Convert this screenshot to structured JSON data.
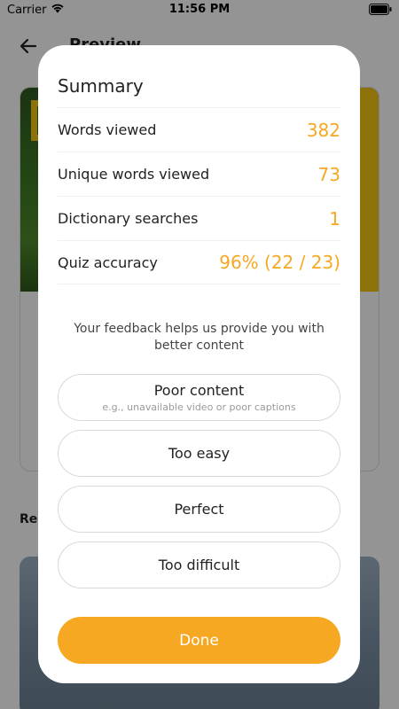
{
  "status_bar": {
    "carrier": "Carrier",
    "time": "11:56 PM"
  },
  "background": {
    "title": "Preview",
    "related_label": "Rel"
  },
  "summary": {
    "title": "Summary",
    "stats": [
      {
        "label": "Words viewed",
        "value": "382"
      },
      {
        "label": "Unique words viewed",
        "value": "73"
      },
      {
        "label": "Dictionary searches",
        "value": "1"
      },
      {
        "label": "Quiz accuracy",
        "value": "96% (22 / 23)"
      }
    ]
  },
  "feedback": {
    "prompt": "Your feedback helps us provide you with better content",
    "options": [
      {
        "label": "Poor content",
        "sublabel": "e.g., unavailable video or poor captions"
      },
      {
        "label": "Too easy"
      },
      {
        "label": "Perfect"
      },
      {
        "label": "Too difficult"
      }
    ]
  },
  "done_label": "Done",
  "colors": {
    "accent": "#f7a823",
    "overlay": "rgba(0,0,0,0.42)"
  }
}
